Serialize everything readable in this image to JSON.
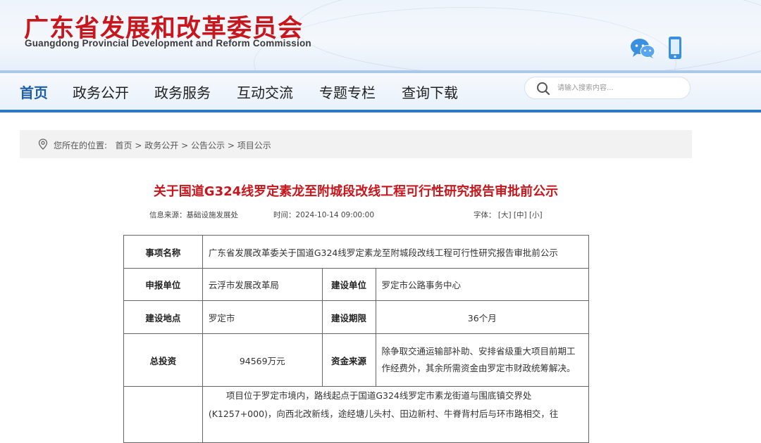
{
  "header": {
    "title_cn": "广东省发展和改革委员会",
    "title_en": "Guangdong Provincial Development and Reform Commission",
    "icons": [
      "wechat-icon",
      "mobile-icon"
    ]
  },
  "nav": {
    "items": [
      "首页",
      "政务公开",
      "政务服务",
      "互动交流",
      "专题专栏",
      "查询下载"
    ],
    "active": "首页",
    "search_placeholder": "请输入搜索内容..."
  },
  "breadcrumb": {
    "prefix": "您所在的位置:",
    "items": [
      "首页",
      "政务公开",
      "公告公示",
      "项目公示"
    ],
    "separator": ">"
  },
  "article": {
    "title": "关于国道G324线罗定素龙至附城段改线工程可行性研究报告审批前公示",
    "source": "信息来源：基础设施发展处",
    "time": "时间：2024-10-14 09:00:00",
    "font_label": "字体：",
    "font_large": "[大]",
    "font_medium": "[中]",
    "font_small": "[小]"
  },
  "table": {
    "r1_label": "事项名称",
    "r1_value": "广东省发展改革委关于国道G324线罗定素龙至附城段改线工程可行性研究报告审批前公示",
    "r2_label": "申报单位",
    "r2_value": "云浮市发展改革局",
    "r2_label2": "建设单位",
    "r2_value2": "罗定市公路事务中心",
    "r3_label": "建设地点",
    "r3_value": "罗定市",
    "r3_label2": "建设期限",
    "r3_value2": "36个月",
    "r4_label": "总投资",
    "r4_value": "94569万元",
    "r4_label2": "资金来源",
    "r4_value2": "除争取交通运输部补助、安排省级重大项目前期工作经费外，其余所需资金由罗定市财政统筹解决。",
    "r5_desc": "项目位于罗定市境内，路线起点于国道G324线罗定市素龙街道与围底镇交界处(K1257+000)，向西北改新线，途经塘儿头村、田边新村、牛脊背村后与环市路相交，往"
  }
}
